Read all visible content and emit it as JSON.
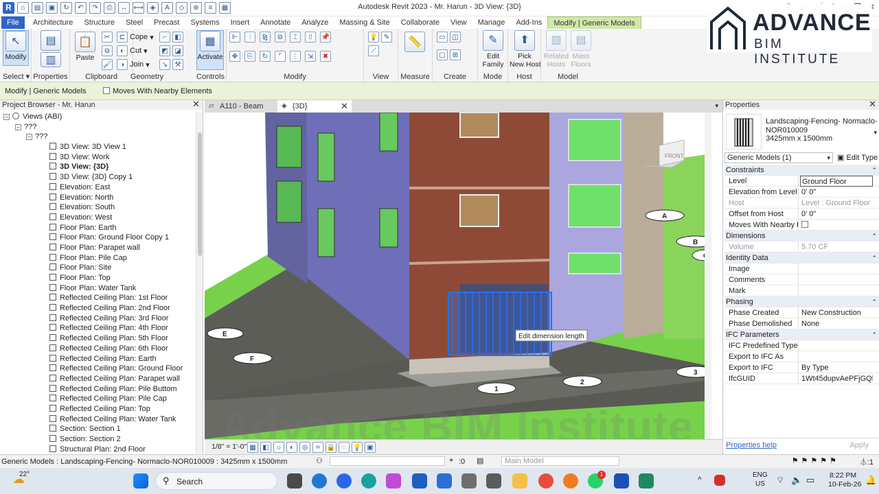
{
  "app": {
    "title": "Autodesk Revit 2023 - Mr. Harun - 3D View: {3D}"
  },
  "brand": {
    "line1": "ADVANCE",
    "line2": "BIM INSTITUTE"
  },
  "tabs": [
    "File",
    "Architecture",
    "Structure",
    "Steel",
    "Precast",
    "Systems",
    "Insert",
    "Annotate",
    "Analyze",
    "Massing & Site",
    "Collaborate",
    "View",
    "Manage",
    "Add-Ins",
    "Modify | Generic Models"
  ],
  "ribbon": {
    "modify_label": "Modify",
    "paste_label": "Paste",
    "cope_label": "Cope",
    "cut_label": "Cut",
    "join_label": "Join",
    "activate_label": "Activate",
    "edit_family_label": "Edit\nFamily",
    "pick_host_label": "Pick\nNew Host",
    "related_hosts_label": "Related\nHosts",
    "mass_floors_label": "Mass\nFloors",
    "panels": {
      "select": "Select ▾",
      "properties": "Properties",
      "clipboard": "Clipboard",
      "geometry": "Geometry",
      "controls": "Controls",
      "modify": "Modify",
      "view": "View",
      "measure": "Measure",
      "create": "Create",
      "mode": "Mode",
      "host": "Host",
      "model": "Model"
    }
  },
  "optbar": {
    "context": "Modify | Generic Models",
    "moves_with": "Moves With Nearby Elements"
  },
  "browser": {
    "title": "Project Browser - Mr. Harun",
    "root": "Views (ABI)",
    "g1": "???",
    "g2": "???",
    "items": [
      "3D View: 3D View 1",
      "3D View: Work",
      "3D View: {3D}",
      "3D View: {3D} Copy 1",
      "Elevation: East",
      "Elevation: North",
      "Elevation: South",
      "Elevation: West",
      "Floor Plan: Earth",
      "Floor Plan: Ground Floor Copy 1",
      "Floor Plan: Parapet wall",
      "Floor Plan: Pile Cap",
      "Floor Plan: Site",
      "Floor Plan: Top",
      "Floor Plan: Water Tank",
      "Reflected Ceiling Plan: 1st Floor",
      "Reflected Ceiling Plan: 2nd Floor",
      "Reflected Ceiling Plan: 3rd Floor",
      "Reflected Ceiling Plan: 4th Floor",
      "Reflected Ceiling Plan: 5th Floor",
      "Reflected Ceiling Plan: 6th Floor",
      "Reflected Ceiling Plan: Earth",
      "Reflected Ceiling Plan: Ground Floor",
      "Reflected Ceiling Plan: Parapet wall",
      "Reflected Ceiling Plan: Pile Buttom",
      "Reflected Ceiling Plan: Pile Cap",
      "Reflected Ceiling Plan: Top",
      "Reflected Ceiling Plan: Water Tank",
      "Section: Section 1",
      "Section: Section 2",
      "Structural Plan: 2nd Floor"
    ]
  },
  "viewtabs": {
    "tab1": "A110 - Beam",
    "tab2": "{3D}"
  },
  "viewport": {
    "tooltip": "Edit dimension length",
    "viewcube": "FRONT",
    "grids": [
      "A",
      "B",
      "C",
      "E",
      "F",
      "1",
      "2",
      "3"
    ],
    "watermark": "Advance BIM Institute"
  },
  "viewbar": {
    "scale": "1/8\" = 1'-0\""
  },
  "props": {
    "title": "Properties",
    "type_name": "Landscaping-Fencing- Normaclo-\nNOR010009\n3425mm x 1500mm",
    "selector": "Generic Models (1)",
    "edit_type": "Edit Type",
    "groups": {
      "constraints": "Constraints",
      "dimensions": "Dimensions",
      "identity": "Identity Data",
      "phasing": "Phasing",
      "ifc": "IFC Parameters"
    },
    "rows": {
      "level": [
        "Level",
        "Ground Floor"
      ],
      "elev": [
        "Elevation from Level",
        "0'  0\""
      ],
      "host": [
        "Host",
        "Level : Ground Floor"
      ],
      "offset": [
        "Offset from Host",
        "0'  0\""
      ],
      "moves": [
        "Moves With Nearby E...",
        ""
      ],
      "volume": [
        "Volume",
        "5.70 CF"
      ],
      "image": [
        "Image",
        ""
      ],
      "comments": [
        "Comments",
        ""
      ],
      "mark": [
        "Mark",
        ""
      ],
      "created": [
        "Phase Created",
        "New Construction"
      ],
      "demolished": [
        "Phase Demolished",
        "None"
      ],
      "ifc_type": [
        "IFC Predefined Type",
        ""
      ],
      "ifc_as": [
        "Export to IFC As",
        ""
      ],
      "ifc_export": [
        "Export to IFC",
        "By Type"
      ],
      "guid": [
        "IfcGUID",
        "1Wt45dupvAePFjGQh..."
      ]
    },
    "help": "Properties help",
    "apply": "Apply"
  },
  "status": {
    "text": "Generic Models : Landscaping-Fencing- Normaclo-NOR010009 : 3425mm x 1500mm",
    "zero": ":0",
    "model": "Main Model"
  },
  "taskbar": {
    "temp": "22°",
    "search": "Search",
    "lang1": "ENG",
    "lang2": "US",
    "time": "8:22 PM",
    "date": "10-Feb-26",
    "badge": "1"
  },
  "colors": {
    "accent": "#2f64c8",
    "context_tab": "#d2e8a9",
    "grass": "#77d14a",
    "brick": "#8f4a37",
    "wall_blue": "#6e6fb8",
    "wall_lilac": "#a9a7de",
    "select_blue": "#1e73ff"
  }
}
